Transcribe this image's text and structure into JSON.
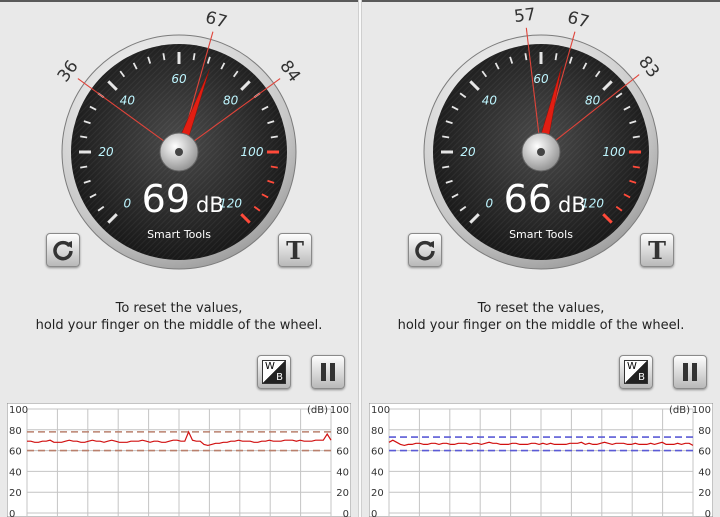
{
  "screens": [
    {
      "gauge": {
        "db_value": "69",
        "db_unit": "dB",
        "brand": "Smart Tools",
        "needle_value": 69,
        "markers": [
          {
            "label": "36",
            "value": 36
          },
          {
            "label": "67",
            "value": 67
          },
          {
            "label": "84",
            "value": 84
          }
        ],
        "scale_labels": [
          "0",
          "20",
          "40",
          "60",
          "80",
          "100",
          "120"
        ]
      },
      "buttons": {
        "reset_icon": "refresh-icon",
        "text_label": "T",
        "wb_w": "W",
        "wb_b": "B",
        "pause_icon": "pause-icon"
      },
      "instructions": {
        "line1": "To reset the values,",
        "line2": "hold your finger on the middle of the wheel."
      },
      "graph": {
        "y_ticks": [
          "100",
          "80",
          "60",
          "40",
          "20",
          "0"
        ],
        "unit": "(dB)",
        "band_color": "#b9806d",
        "band": [
          78,
          60
        ],
        "series": [
          69,
          69,
          68,
          68,
          69,
          69,
          70,
          68,
          68,
          68,
          69,
          70,
          69,
          69,
          68,
          68,
          69,
          70,
          69,
          69,
          68,
          69,
          70,
          69,
          68,
          68,
          68,
          69,
          69,
          69,
          70,
          69,
          68,
          69,
          69,
          68,
          68,
          69,
          70,
          70,
          69,
          69,
          78,
          70,
          69,
          69,
          66,
          65,
          66,
          67,
          67,
          68,
          68,
          69,
          69,
          70,
          69,
          69,
          69,
          68,
          68,
          69,
          69,
          70,
          69,
          69,
          69,
          70,
          70,
          70,
          69,
          70,
          69,
          69,
          69,
          70,
          70,
          70,
          76,
          70
        ]
      }
    },
    {
      "gauge": {
        "db_value": "66",
        "db_unit": "dB",
        "brand": "Smart Tools",
        "needle_value": 66,
        "markers": [
          {
            "label": "57",
            "value": 57
          },
          {
            "label": "67",
            "value": 67
          },
          {
            "label": "83",
            "value": 83
          }
        ],
        "scale_labels": [
          "0",
          "20",
          "40",
          "60",
          "80",
          "100",
          "120"
        ]
      },
      "buttons": {
        "reset_icon": "refresh-icon",
        "text_label": "T",
        "wb_w": "W",
        "wb_b": "B",
        "pause_icon": "pause-icon"
      },
      "instructions": {
        "line1": "To reset the values,",
        "line2": "hold your finger on the middle of the wheel."
      },
      "graph": {
        "y_ticks": [
          "100",
          "80",
          "60",
          "40",
          "20",
          "0"
        ],
        "unit": "(dB)",
        "band_color": "#5b5bd6",
        "band": [
          73,
          60
        ],
        "series": [
          68,
          70,
          68,
          66,
          65,
          66,
          66,
          67,
          67,
          66,
          66,
          67,
          67,
          66,
          67,
          67,
          66,
          66,
          67,
          67,
          67,
          66,
          67,
          67,
          66,
          67,
          68,
          67,
          67,
          66,
          66,
          66,
          67,
          67,
          66,
          66,
          66,
          67,
          67,
          66,
          67,
          66,
          67,
          66,
          66,
          66,
          66,
          67,
          67,
          67,
          68,
          66,
          67,
          66,
          66,
          67,
          68,
          67,
          66,
          67,
          67,
          67,
          66,
          66,
          67,
          66,
          66,
          66,
          67,
          66,
          67,
          68,
          66,
          66,
          66,
          67,
          66,
          67,
          67,
          65
        ]
      }
    }
  ]
}
